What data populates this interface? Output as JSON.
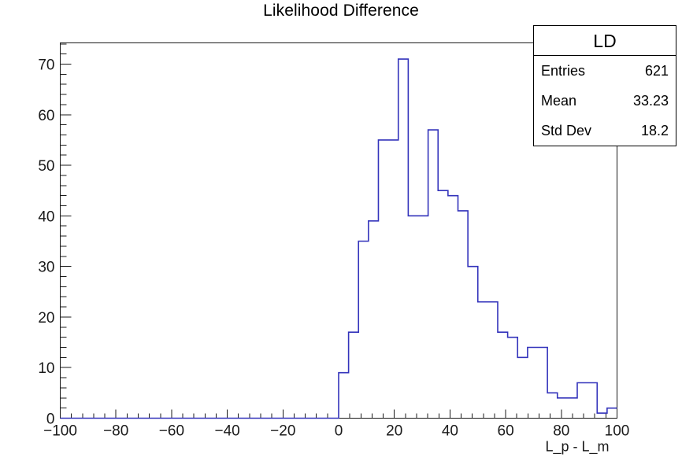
{
  "title": "Likelihood Difference",
  "stats": {
    "name": "LD",
    "rows": [
      {
        "label": "Entries",
        "value": "621"
      },
      {
        "label": "Mean",
        "value": "33.23"
      },
      {
        "label": "Std Dev",
        "value": "18.2"
      }
    ]
  },
  "colors": {
    "histogram_line": "#3333bb",
    "axis": "#1a1a1a",
    "frame": "#1a1a1a",
    "text": "#000000",
    "background": "#ffffff"
  },
  "chart_data": {
    "type": "bar",
    "title": "Likelihood Difference",
    "xlabel": "L_p - L_m",
    "ylabel": "",
    "xlim": [
      -100,
      100
    ],
    "ylim": [
      0,
      74.2
    ],
    "grid": false,
    "legend": "none",
    "style": "step-histogram",
    "bin_width": 3.5714,
    "n_bins": 56,
    "xticks": [
      -100,
      -80,
      -60,
      -40,
      -20,
      0,
      20,
      40,
      60,
      80,
      100
    ],
    "xminor_step": 4,
    "yticks": [
      0,
      10,
      20,
      30,
      40,
      50,
      60,
      70
    ],
    "yminor_step": 2,
    "bin_left_edges": [
      -100,
      -96.43,
      -92.86,
      -89.29,
      -85.71,
      -82.14,
      -78.57,
      -75,
      -71.43,
      -67.86,
      -64.29,
      -60.71,
      -57.14,
      -53.57,
      -50,
      -46.43,
      -42.86,
      -39.29,
      -35.71,
      -32.14,
      -28.57,
      -25,
      -21.43,
      -17.86,
      -14.29,
      -10.71,
      -7.14,
      -3.57,
      0,
      3.57,
      7.14,
      10.71,
      14.29,
      17.86,
      21.43,
      25,
      28.57,
      32.14,
      35.71,
      39.29,
      42.86,
      46.43,
      50,
      53.57,
      57.14,
      60.71,
      64.29,
      67.86,
      71.43,
      75,
      78.57,
      82.14,
      85.71,
      89.29,
      92.86,
      96.43
    ],
    "values": [
      0,
      0,
      0,
      0,
      0,
      0,
      0,
      0,
      0,
      0,
      0,
      0,
      0,
      0,
      0,
      0,
      0,
      0,
      0,
      0,
      0,
      0,
      0,
      0,
      0,
      0,
      0,
      0,
      9,
      17,
      35,
      39,
      55,
      55,
      71,
      40,
      40,
      57,
      45,
      44,
      41,
      30,
      23,
      23,
      17,
      16,
      12,
      14,
      14,
      5,
      4,
      4,
      7,
      7,
      1,
      2
    ],
    "peak_value": 71,
    "peak_bin_center": 26.8
  }
}
